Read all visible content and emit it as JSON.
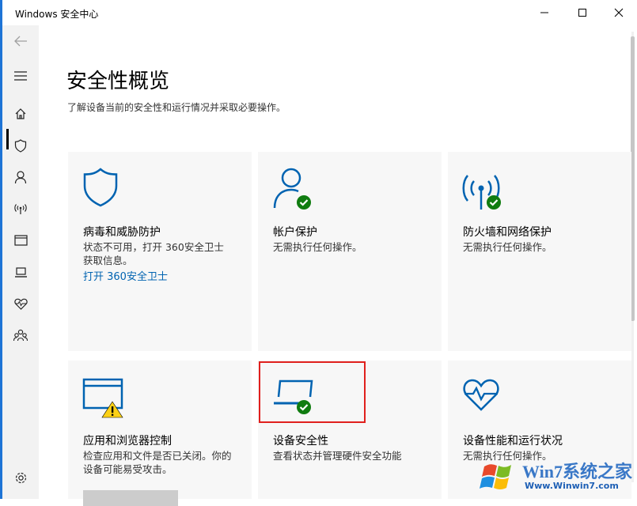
{
  "window": {
    "title": "Windows 安全中心",
    "controls": {
      "minimize": "minimize-icon",
      "maximize": "maximize-icon",
      "close": "close-icon"
    }
  },
  "sidebar": {
    "items": [
      {
        "name": "back",
        "icon": "back-arrow-icon"
      },
      {
        "name": "menu",
        "icon": "hamburger-icon"
      },
      {
        "name": "home",
        "icon": "home-icon",
        "selected": true
      },
      {
        "name": "virus-protection",
        "icon": "shield-icon"
      },
      {
        "name": "account-protection",
        "icon": "person-icon"
      },
      {
        "name": "firewall",
        "icon": "antenna-icon"
      },
      {
        "name": "app-browser",
        "icon": "browser-window-icon"
      },
      {
        "name": "device-security",
        "icon": "laptop-icon"
      },
      {
        "name": "device-performance",
        "icon": "heart-pulse-icon"
      },
      {
        "name": "family",
        "icon": "family-icon"
      },
      {
        "name": "settings",
        "icon": "gear-icon"
      }
    ]
  },
  "main": {
    "title": "安全性概览",
    "subtitle": "了解设备当前的安全性和运行情况并采取必要操作。",
    "tiles": [
      {
        "title": "病毒和威胁防护",
        "desc": "状态不可用，打开 360安全卫士获取信息。",
        "link": "打开 360安全卫士",
        "icon": "shield-icon"
      },
      {
        "title": "帐户保护",
        "desc": "无需执行任何操作。",
        "icon": "person-check-icon"
      },
      {
        "title": "防火墙和网络保护",
        "desc": "无需执行任何操作。",
        "icon": "antenna-check-icon"
      },
      {
        "title": "应用和浏览器控制",
        "desc": "检查应用和文件是否已关闭。你的设备可能易受攻击。",
        "icon": "browser-warning-icon"
      },
      {
        "title": "设备安全性",
        "desc": "查看状态并管理硬件安全功能",
        "icon": "laptop-check-icon"
      },
      {
        "title": "设备性能和运行状况",
        "desc": "无需执行任何操作。",
        "icon": "heart-pulse-icon"
      }
    ]
  },
  "watermark": {
    "top": "Win7系统之家",
    "bottom": "Www.Winwin7.com"
  },
  "colors": {
    "accent": "#0063b1",
    "ok": "#107c10",
    "warning": "#fcd116",
    "highlight": "#e0201d"
  }
}
